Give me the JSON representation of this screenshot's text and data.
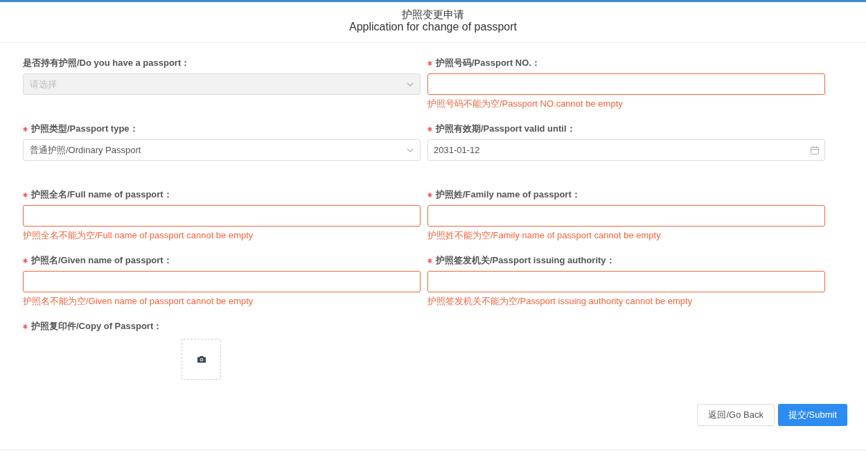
{
  "header": {
    "title_zh": "护照变更申请",
    "title_en": "Application for change of passport"
  },
  "fields": [
    {
      "kind": "select",
      "label": "是否持有护照/Do you have a passport：",
      "required": false,
      "placeholder": "请选择",
      "disabled": true,
      "invalid": false
    },
    {
      "kind": "text",
      "label": "护照号码/Passport NO.：",
      "required": true,
      "disabled": false,
      "invalid": true,
      "error": "护照号码不能为空/Passport NO.cannot be empty"
    },
    {
      "kind": "select",
      "label": "护照类型/Passport type：",
      "required": true,
      "value": "普通护照/Ordinary Passport",
      "disabled": false,
      "invalid": false
    },
    {
      "kind": "date",
      "label": "护照有效期/Passport valid until：",
      "required": true,
      "value": "2031-01-12",
      "disabled": false,
      "invalid": false
    },
    {
      "kind": "text",
      "label": "护照全名/Full name of passport：",
      "required": true,
      "disabled": false,
      "invalid": true,
      "error": "护照全名不能为空/Full name of passport cannot be empty"
    },
    {
      "kind": "text",
      "label": "护照姓/Family name of passport：",
      "required": true,
      "disabled": false,
      "invalid": true,
      "error": "护照姓不能为空/Family name of passport cannot be empty"
    },
    {
      "kind": "text",
      "label": "护照名/Given name of passport：",
      "required": true,
      "disabled": false,
      "invalid": true,
      "error": "护照名不能为空/Given name of passport cannot be empty"
    },
    {
      "kind": "text",
      "label": "护照签发机关/Passport issuing authority：",
      "required": true,
      "disabled": false,
      "invalid": true,
      "error": "护照签发机关不能为空/Passport issuing authority cannot be empty"
    },
    {
      "kind": "upload",
      "label": "护照复印件/Copy of Passport：",
      "required": true
    }
  ],
  "buttons": [
    {
      "label": "返回/Go Back",
      "kind": "secondary"
    },
    {
      "label": "提交/Submit",
      "kind": "primary"
    }
  ]
}
